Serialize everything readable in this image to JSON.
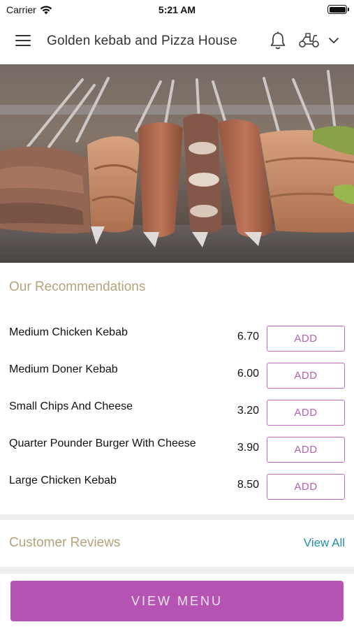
{
  "status_bar": {
    "carrier": "Carrier",
    "time": "5:21 AM"
  },
  "header": {
    "title": "Golden kebab and Pizza House",
    "icons": [
      "menu-icon",
      "bell-icon",
      "scooter-icon",
      "chevron-down-icon"
    ]
  },
  "recommendations": {
    "title": "Our Recommendations",
    "items": [
      {
        "name": "Medium Chicken Kebab",
        "price": "6.70",
        "button": "ADD"
      },
      {
        "name": "Medium Doner Kebab",
        "price": "6.00",
        "button": "ADD"
      },
      {
        "name": "Small Chips And Cheese",
        "price": "3.20",
        "button": "ADD"
      },
      {
        "name": "Quarter Pounder Burger With Cheese",
        "price": "3.90",
        "button": "ADD"
      },
      {
        "name": "Large Chicken Kebab",
        "price": "8.50",
        "button": "ADD"
      }
    ]
  },
  "reviews": {
    "title": "Customer Reviews",
    "view_all": "View All"
  },
  "footer": {
    "view_menu": "VIEW MENU"
  },
  "colors": {
    "accent": "#b554b2",
    "section_title": "#b5a27d",
    "link": "#1e8fa7"
  }
}
